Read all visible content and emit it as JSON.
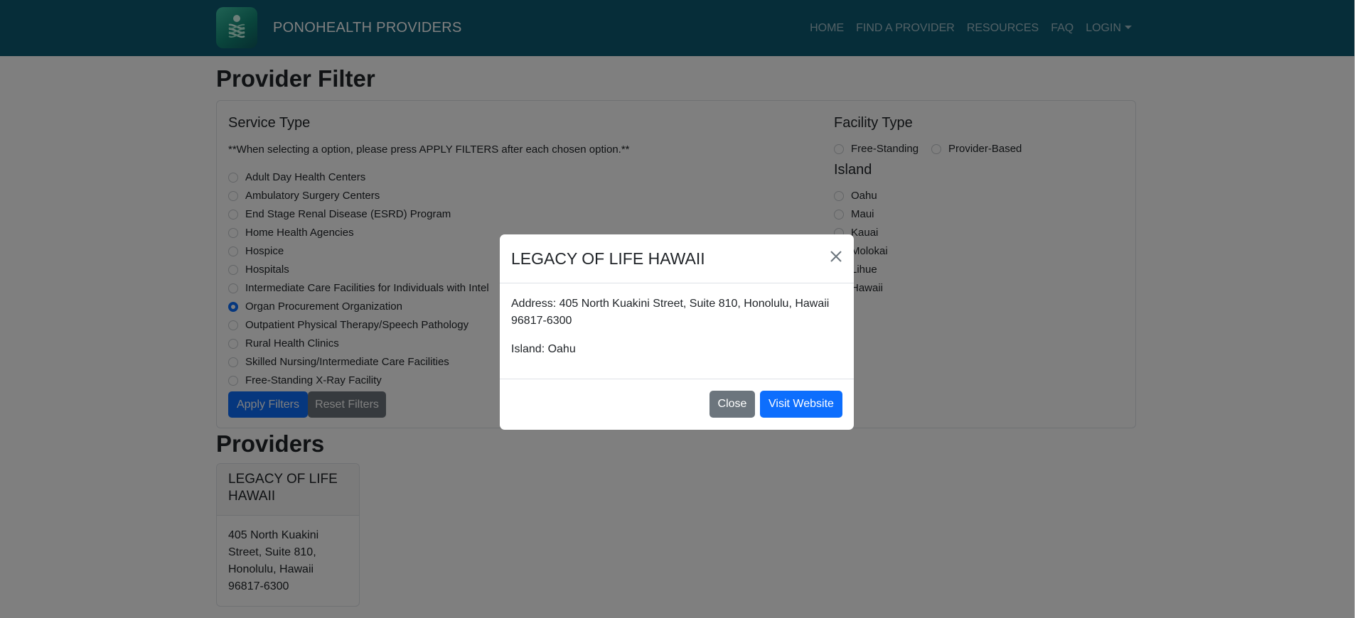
{
  "navbar": {
    "brand": "PONOHEALTH PROVIDERS",
    "links": [
      {
        "label": "HOME"
      },
      {
        "label": "FIND A PROVIDER"
      },
      {
        "label": "RESOURCES"
      },
      {
        "label": "FAQ"
      },
      {
        "label": "LOGIN"
      }
    ]
  },
  "filter": {
    "heading": "Provider Filter",
    "service_type": {
      "title": "Service Type",
      "note": "**When selecting a option, please press APPLY FILTERS after each chosen option.**",
      "options": [
        {
          "label": "Adult Day Health Centers",
          "checked": false
        },
        {
          "label": "Ambulatory Surgery Centers",
          "checked": false
        },
        {
          "label": "End Stage Renal Disease (ESRD) Program",
          "checked": false
        },
        {
          "label": "Home Health Agencies",
          "checked": false
        },
        {
          "label": "Hospice",
          "checked": false
        },
        {
          "label": "Hospitals",
          "checked": false
        },
        {
          "label": "Intermediate Care Facilities for Individuals with Intel",
          "checked": false
        },
        {
          "label": "Organ Procurement Organization",
          "checked": true
        },
        {
          "label": "Outpatient Physical Therapy/Speech Pathology",
          "checked": false
        },
        {
          "label": "Rural Health Clinics",
          "checked": false
        },
        {
          "label": "Skilled Nursing/Intermediate Care Facilities",
          "checked": false
        },
        {
          "label": "Free-Standing X-Ray Facility",
          "checked": false
        }
      ]
    },
    "facility_type": {
      "title": "Facility Type",
      "options": [
        {
          "label": "Free-Standing",
          "checked": false
        },
        {
          "label": "Provider-Based",
          "checked": false
        }
      ]
    },
    "island": {
      "title": "Island",
      "options": [
        {
          "label": "Oahu",
          "checked": false
        },
        {
          "label": "Maui",
          "checked": false
        },
        {
          "label": "Kauai",
          "checked": false
        },
        {
          "label": "Molokai",
          "checked": false
        },
        {
          "label": "Lihue",
          "checked": false
        },
        {
          "label": "Hawaii",
          "checked": false
        }
      ]
    },
    "apply_label": "Apply Filters",
    "reset_label": "Reset Filters"
  },
  "providers": {
    "heading": "Providers",
    "cards": [
      {
        "name": "LEGACY OF LIFE HAWAII",
        "address": "405 North Kuakini Street, Suite 810, Honolulu, Hawaii 96817-6300"
      }
    ]
  },
  "modal": {
    "title": "LEGACY OF LIFE HAWAII",
    "address_line": "Address: 405 North Kuakini Street, Suite 810, Honolulu, Hawaii 96817-6300",
    "island_line": "Island: Oahu",
    "close_label": "Close",
    "visit_label": "Visit Website"
  },
  "colors": {
    "navbar": "#0d5a73",
    "primary": "#0d6efd",
    "secondary": "#6c757d"
  }
}
